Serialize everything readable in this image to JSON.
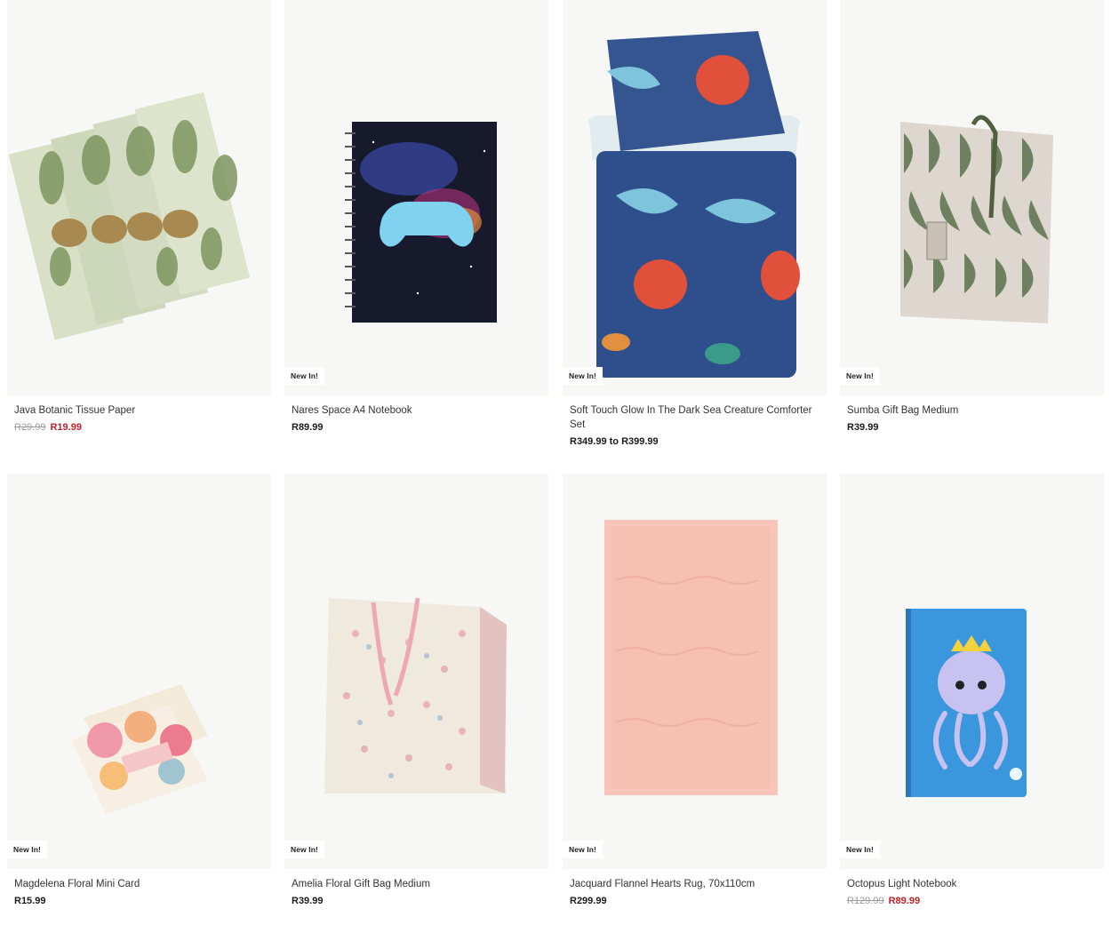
{
  "products": [
    {
      "name": "Java Botanic Tissue Paper",
      "badge": "",
      "old_price": "R29.99",
      "price": "R19.99",
      "on_sale": true,
      "image": "tissue-paper-image"
    },
    {
      "name": "Nares Space A4 Notebook",
      "badge": "New In!",
      "old_price": "",
      "price": "R89.99",
      "on_sale": false,
      "image": "notebook-image"
    },
    {
      "name": "Soft Touch Glow In The Dark Sea Creature Comforter Set",
      "badge": "New In!",
      "old_price": "",
      "price": "R349.99 to R399.99",
      "on_sale": false,
      "image": "comforter-image"
    },
    {
      "name": "Sumba Gift Bag Medium",
      "badge": "New In!",
      "old_price": "",
      "price": "R39.99",
      "on_sale": false,
      "image": "gift-bag-image"
    },
    {
      "name": "Magdelena Floral Mini Card",
      "badge": "New In!",
      "old_price": "",
      "price": "R15.99",
      "on_sale": false,
      "image": "mini-card-image"
    },
    {
      "name": "Amelia Floral Gift Bag Medium",
      "badge": "New In!",
      "old_price": "",
      "price": "R39.99",
      "on_sale": false,
      "image": "floral-bag-image"
    },
    {
      "name": "Jacquard Flannel Hearts Rug, 70x110cm",
      "badge": "New In!",
      "old_price": "",
      "price": "R299.99",
      "on_sale": false,
      "image": "rug-image"
    },
    {
      "name": "Octopus Light Notebook",
      "badge": "New In!",
      "old_price": "R129.99",
      "price": "R89.99",
      "on_sale": true,
      "image": "octopus-notebook-image"
    }
  ],
  "colors": {
    "sale": "#c42027",
    "image_bg": "#f7f7f6"
  }
}
